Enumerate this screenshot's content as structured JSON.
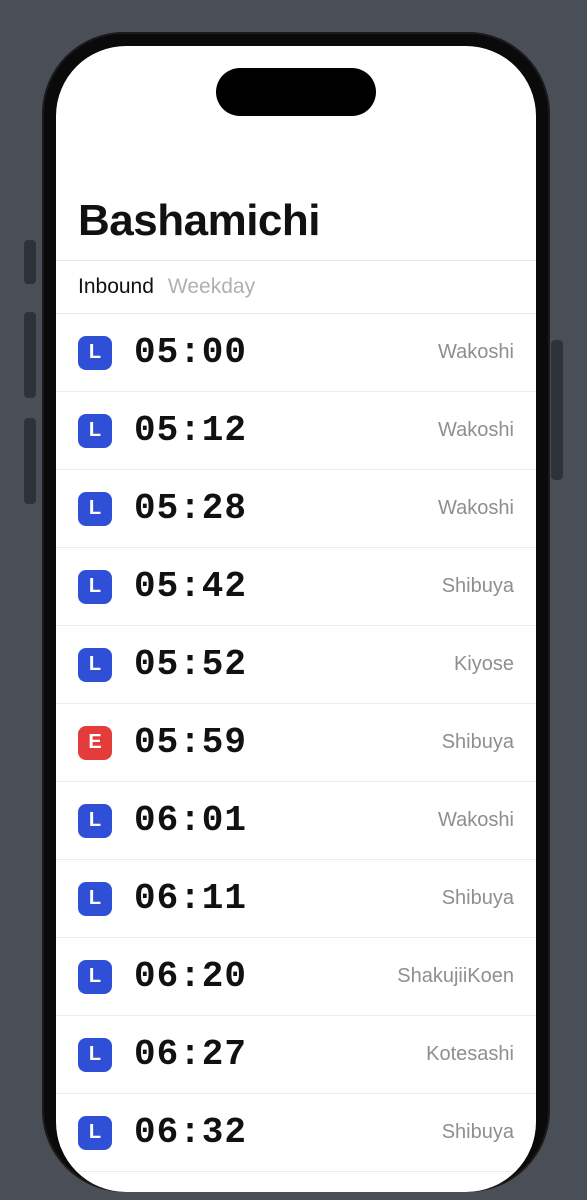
{
  "station": {
    "title": "Bashamichi"
  },
  "filters": {
    "direction": "Inbound",
    "daytype": "Weekday"
  },
  "badge_labels": {
    "L": "L",
    "E": "E"
  },
  "badge_colors": {
    "L": "#2f4fd6",
    "E": "#e43b3b"
  },
  "rows": [
    {
      "type": "L",
      "time": "05:00",
      "dest": "Wakoshi"
    },
    {
      "type": "L",
      "time": "05:12",
      "dest": "Wakoshi"
    },
    {
      "type": "L",
      "time": "05:28",
      "dest": "Wakoshi"
    },
    {
      "type": "L",
      "time": "05:42",
      "dest": "Shibuya"
    },
    {
      "type": "L",
      "time": "05:52",
      "dest": "Kiyose"
    },
    {
      "type": "E",
      "time": "05:59",
      "dest": "Shibuya"
    },
    {
      "type": "L",
      "time": "06:01",
      "dest": "Wakoshi"
    },
    {
      "type": "L",
      "time": "06:11",
      "dest": "Shibuya"
    },
    {
      "type": "L",
      "time": "06:20",
      "dest": "ShakujiiKoen"
    },
    {
      "type": "L",
      "time": "06:27",
      "dest": "Kotesashi"
    },
    {
      "type": "L",
      "time": "06:32",
      "dest": "Shibuya"
    }
  ]
}
